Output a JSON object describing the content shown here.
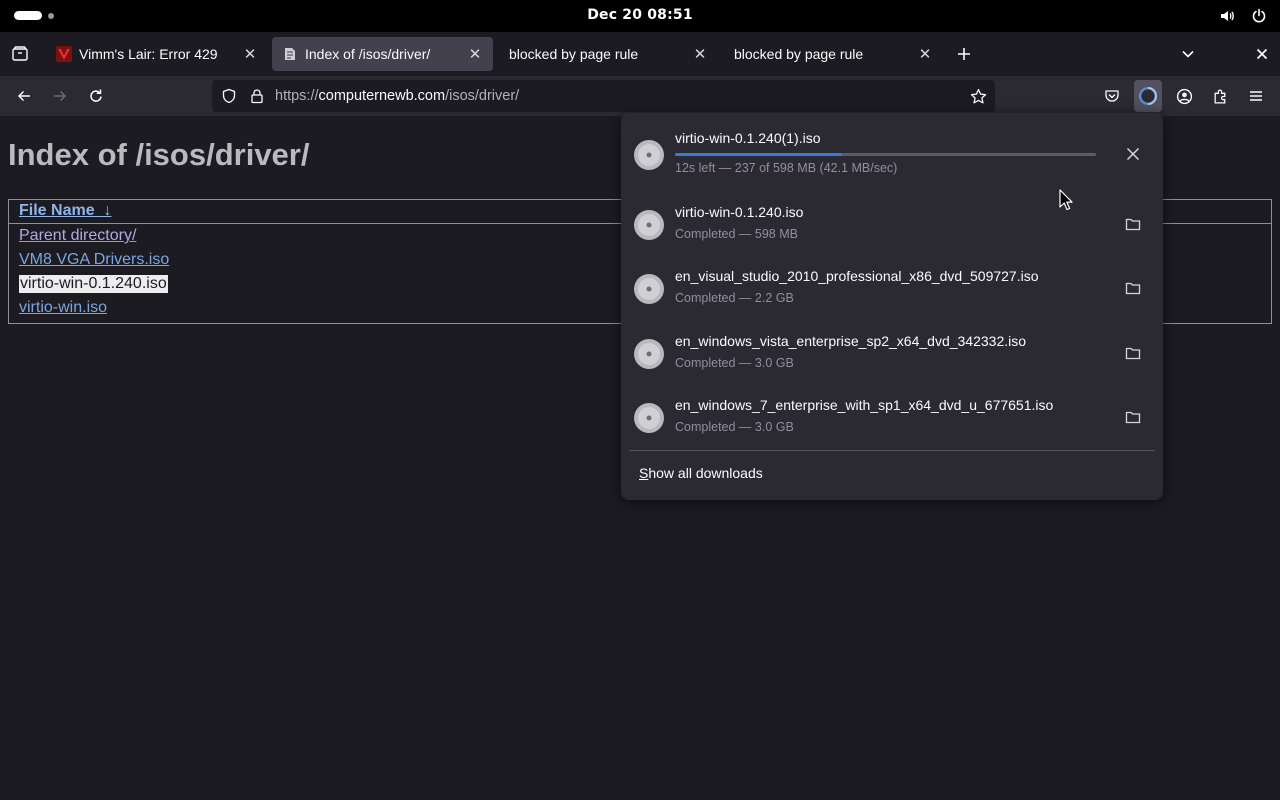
{
  "system_bar": {
    "datetime": "Dec 20  08:51",
    "icons": [
      "activities-indicator",
      "volume-icon",
      "power-icon"
    ]
  },
  "tabs": [
    {
      "title": "Vimm's Lair: Error 429",
      "icon": "vimm-favicon",
      "active": false
    },
    {
      "title": "Index of /isos/driver/",
      "icon": "page-favicon",
      "active": true
    },
    {
      "title": "blocked by page rule",
      "icon": "",
      "active": false
    },
    {
      "title": "blocked by page rule",
      "icon": "",
      "active": false
    }
  ],
  "navbar": {
    "url_prefix": "https://",
    "url_host": "computernewb.com",
    "url_path": "/isos/driver/"
  },
  "page": {
    "title": "Index of /isos/driver/",
    "column_header": "File Name",
    "sort_indicator": "↓",
    "files": [
      {
        "name": "Parent directory/",
        "state": "visited"
      },
      {
        "name": "VM8 VGA Drivers.iso",
        "state": "link"
      },
      {
        "name": "virtio-win-0.1.240.iso",
        "state": "selected"
      },
      {
        "name": "virtio-win.iso",
        "state": "link"
      }
    ]
  },
  "downloads": {
    "items": [
      {
        "name": "virtio-win-0.1.240(1).iso",
        "status": "12s left — 237 of 598 MB (42.1 MB/sec)",
        "progress": 0.396,
        "in_progress": true,
        "action_icon": "cancel-icon"
      },
      {
        "name": "virtio-win-0.1.240.iso",
        "status": "Completed — 598 MB",
        "in_progress": false,
        "action_icon": "folder-icon"
      },
      {
        "name": "en_visual_studio_2010_professional_x86_dvd_509727.iso",
        "status": "Completed — 2.2 GB",
        "in_progress": false,
        "action_icon": "folder-icon"
      },
      {
        "name": "en_windows_vista_enterprise_sp2_x64_dvd_342332.iso",
        "status": "Completed — 3.0 GB",
        "in_progress": false,
        "action_icon": "folder-icon"
      },
      {
        "name": "en_windows_7_enterprise_with_sp1_x64_dvd_u_677651.iso",
        "status": "Completed — 3.0 GB",
        "in_progress": false,
        "action_icon": "folder-icon"
      }
    ],
    "show_all_label": "Show all downloads"
  },
  "colors": {
    "progress": "#3a7ad8",
    "link": "#7aa6e0",
    "visited_link": "#b6a6e6",
    "panel_bg": "#2b2a33",
    "page_bg": "#1c1b22"
  }
}
